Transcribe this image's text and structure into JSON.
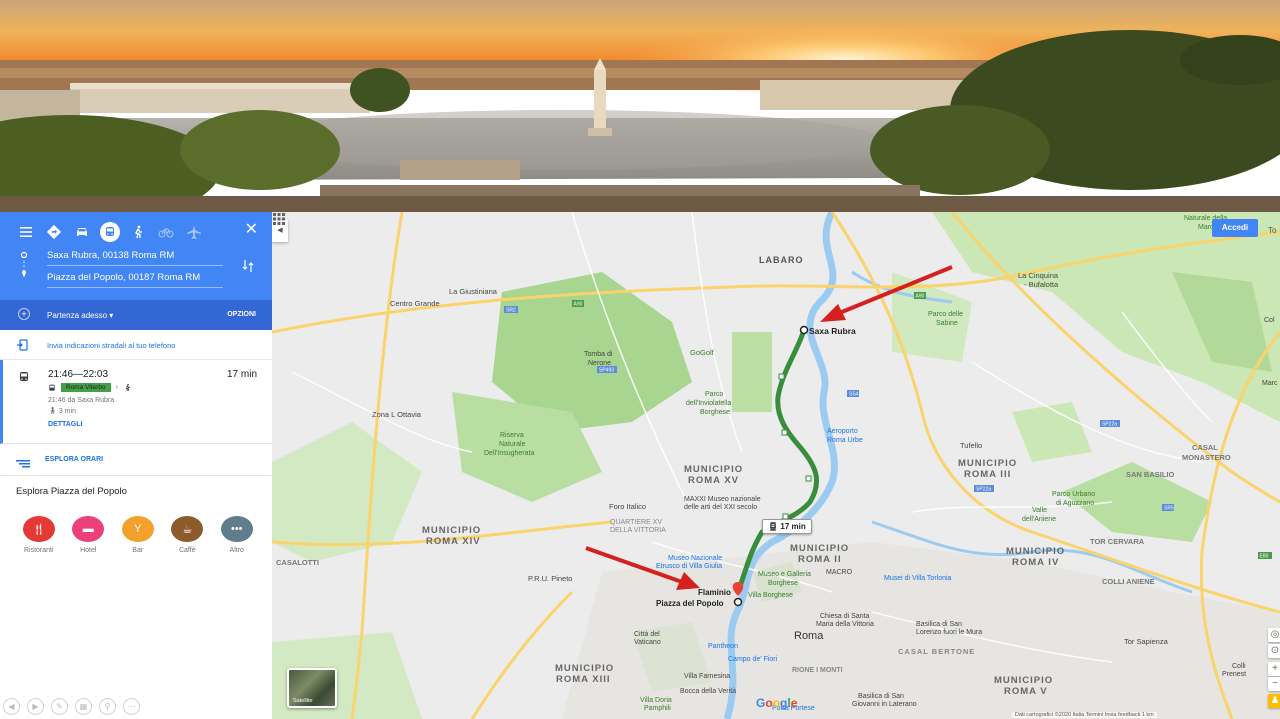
{
  "header": {
    "image_description_alt": ""
  },
  "panel": {
    "modes": [
      "directions-icon",
      "car-icon",
      "transit-icon",
      "walk-icon",
      "bike-icon",
      "flight-icon"
    ],
    "origin": "Saxa Rubra, 00138 Roma RM",
    "destination": "Piazza del Popolo, 00187 Roma RM",
    "depart_label": "Partenza adesso",
    "options_label": "OPZIONI",
    "send_label": "Invia indicazioni stradali al tuo telefono",
    "trip": {
      "time_range": "21:46—22:03",
      "duration": "17 min",
      "line": "Roma Viterbo",
      "from_text": "21:46 da Saxa Rubra",
      "walk_text": "3 min",
      "details_label": "DETTAGLI"
    },
    "explore_times_label": "ESPLORA ORARI",
    "explore_title": "Esplora Piazza del Popolo",
    "categories": [
      {
        "label": "Ristoranti",
        "color": "#e53935",
        "icon": "restaurant-icon"
      },
      {
        "label": "Hotel",
        "color": "#ec407a",
        "icon": "hotel-icon"
      },
      {
        "label": "Bar",
        "color": "#f4a12c",
        "icon": "bar-icon"
      },
      {
        "label": "Caffè",
        "color": "#8d5a2b",
        "icon": "cafe-icon"
      },
      {
        "label": "Altro",
        "color": "#607d8b",
        "icon": "more-icon"
      }
    ]
  },
  "map": {
    "signin_label": "Accedi",
    "route_badge": "17 min",
    "satellite_label": "Satellite",
    "google_logo": "Google",
    "attribution": "Dati cartografici ©2020   Italia   Termini   Invia feedback   1 km",
    "right_clip": "To",
    "labels": {
      "labaro": "LABARO",
      "saxa_rubra": "Saxa Rubra",
      "la_giustiniana": "La Giustiniana",
      "centro_grande": "Centro Grande",
      "cinquina": "La Cinquina\n- Bufalotta",
      "parco_sabine": "Parco delle\nSabine",
      "naturale": "Naturale della\nMarcigliana",
      "tomba_nerone": "Tomba di\nNerone",
      "gogolf": "GoGolf",
      "parco_inviolatella": "Parco\ndell'Inviolatella\nBorghese",
      "zona_ottavia": "Zona L Ottavia",
      "aeroporto": "Aeroporto\nRoma Urbe",
      "tufello": "Tufello",
      "riserva": "Riserva\nNaturale\nDell'Insugherata",
      "municipio_xv": "MUNICIPIO\nROMA XV",
      "municipio_iii": "MUNICIPIO\nROMA III",
      "casal_monastero": "CASAL\nMONASTERO",
      "san_basilio": "SAN BASILIO",
      "maxxi": "MAXXI Museo nazionale\ndelle arti del XXI secolo",
      "foro_italico": "Foro Italico",
      "quartiere_xv": "QUARTIERE XV\nDELLA VITTORIA",
      "parco_aguzzano": "Parco Urbano\ndi Aguzzano",
      "valle_aniene": "Valle\ndell'Aniene",
      "municipio_xiv": "MUNICIPIO\nROMA XIV",
      "casalotti": "CASALOTTI",
      "municipio_ii": "MUNICIPIO\nROMA II",
      "tor_cervara": "TOR CERVARA",
      "municipio_iv": "MUNICIPIO\nROMA IV",
      "colli_aniene": "COLLI ANIENE",
      "museo_giulia": "Museo Nazionale\nEtrusco di Villa Giulia",
      "macro": "MACRO",
      "villa_torlonia": "Musei di Villa Torlonia",
      "pru_pineto": "P.R.U. Pineto",
      "flaminio": "Flaminio",
      "piazza_popolo": "Piazza del Popolo",
      "villa_borghese": "Museo e Galleria\nBorghese",
      "villa_borghese2": "Villa Borghese",
      "chiesa": "Chiesa di Santa\nMaria della Vittoria",
      "basilica_lorenzo": "Basilica di San\nLorenzo fuori le Mura",
      "roma": "Roma",
      "citta_vaticano": "Città del\nVaticano",
      "pantheon": "Pantheon",
      "campo_fiori": "Campo de' Fiori",
      "rione_monti": "RIONE I MONTI",
      "casal_bertone": "CASAL BERTONE",
      "tor_sapienza": "Tor Sapienza",
      "municipio_xiii": "MUNICIPIO\nROMA XIII",
      "villa_farnesina": "Villa Farnesina",
      "bocca_verita": "Bocca della Verità",
      "villa_doria": "Villa Doria\nPamphili",
      "porta_portese": "Porta Portese",
      "basilica_giovanni": "Basilica di San\nGiovanni in Laterano",
      "municipio_v": "MUNICIPIO\nROMA V",
      "colli_prenestino": "Colli\nPrenest",
      "marc": "Marc",
      "col": "Col"
    }
  }
}
